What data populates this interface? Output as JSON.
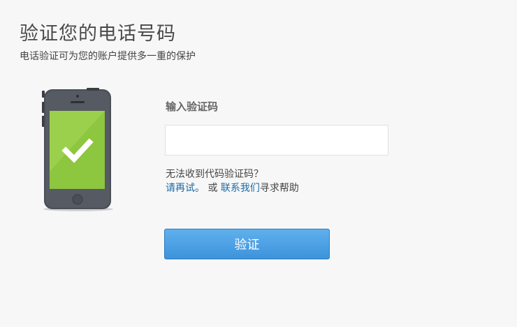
{
  "header": {
    "title": "验证您的电话号码",
    "subtitle": "电话验证可为您的账户提供多一重的保护"
  },
  "form": {
    "code_label": "输入验证码",
    "code_value": "",
    "no_code_text": "无法收到代码验证码？",
    "retry_link": "请再试。",
    "or_text": " 或 ",
    "contact_link": "联系我们",
    "help_suffix": "寻求帮助",
    "verify_label": "验证"
  },
  "illustration": {
    "icon": "phone-with-checkmark-icon"
  },
  "colors": {
    "link": "#1b6aa5",
    "button": "#4ba0e4",
    "screen": "#8dc63f"
  }
}
